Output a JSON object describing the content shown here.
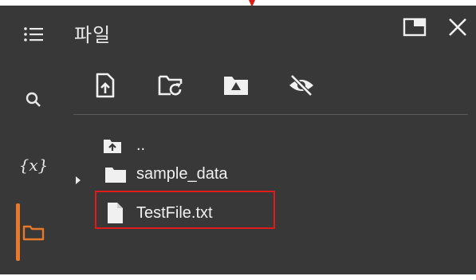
{
  "panel": {
    "title": "파일"
  },
  "rail": {
    "items": [
      {
        "name": "menu",
        "label": ""
      },
      {
        "name": "search",
        "label": ""
      },
      {
        "name": "variables",
        "label": "{x}"
      },
      {
        "name": "files",
        "label": ""
      }
    ]
  },
  "tree": {
    "parent_label": "..",
    "items": [
      {
        "label": "sample_data",
        "type": "folder"
      },
      {
        "label": "TestFile.txt",
        "type": "file"
      }
    ]
  },
  "colors": {
    "panel_bg": "#383838",
    "accent": "#e9792a",
    "highlight": "#e01a1a",
    "text": "#f0f0f0"
  }
}
